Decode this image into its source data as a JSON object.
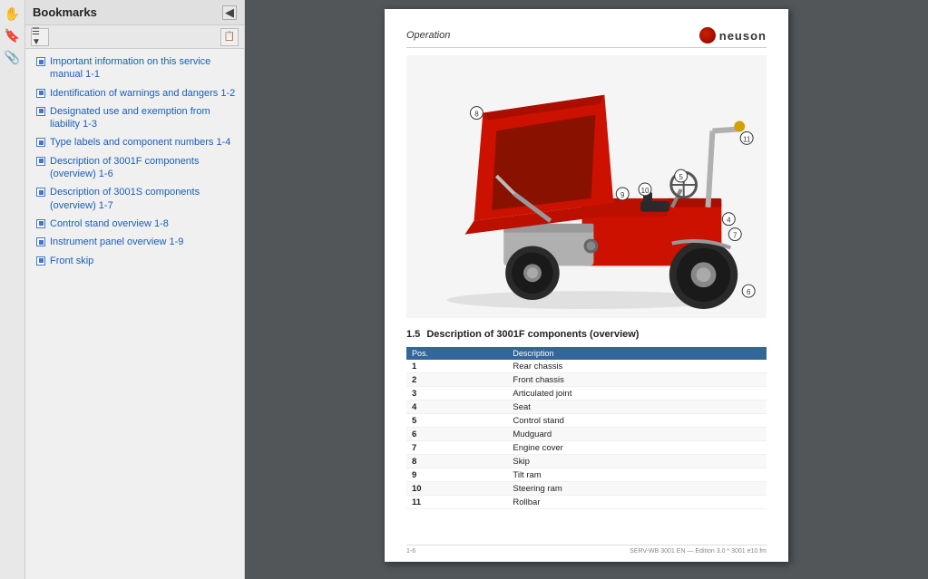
{
  "toolbar": {
    "icons": [
      {
        "name": "hand-icon",
        "symbol": "✋"
      },
      {
        "name": "bookmark-icon",
        "symbol": "🔖"
      },
      {
        "name": "paperclip-icon",
        "symbol": "📎"
      }
    ]
  },
  "bookmarks_panel": {
    "title": "Bookmarks",
    "close_label": "◀",
    "toolbar_buttons": [
      {
        "name": "options-button",
        "symbol": "☰"
      },
      {
        "name": "expand-button",
        "symbol": "▼"
      },
      {
        "name": "add-bookmark-button",
        "symbol": "📋"
      }
    ],
    "items": [
      {
        "id": 1,
        "text": "Important information on this service manual 1-1"
      },
      {
        "id": 2,
        "text": "Identification of warnings and dangers 1-2"
      },
      {
        "id": 3,
        "text": "Designated use and exemption from liability 1-3"
      },
      {
        "id": 4,
        "text": "Type labels and component numbers 1-4"
      },
      {
        "id": 5,
        "text": "Description of 3001F components (overview) 1-6"
      },
      {
        "id": 6,
        "text": "Description of 3001S components (overview) 1-7"
      },
      {
        "id": 7,
        "text": "Control stand overview 1-8"
      },
      {
        "id": 8,
        "text": "Instrument panel overview 1-9"
      },
      {
        "id": 9,
        "text": "Front skip"
      }
    ]
  },
  "document": {
    "header_title": "Operation",
    "logo_text": "neuson",
    "section_number": "1.5",
    "section_title": "Description of 3001F components (overview)",
    "table": {
      "col_pos": "Pos.",
      "col_desc": "Description",
      "rows": [
        {
          "pos": "1",
          "desc": "Rear chassis"
        },
        {
          "pos": "2",
          "desc": "Front chassis"
        },
        {
          "pos": "3",
          "desc": "Articulated joint"
        },
        {
          "pos": "4",
          "desc": "Seat"
        },
        {
          "pos": "5",
          "desc": "Control stand"
        },
        {
          "pos": "6",
          "desc": "Mudguard"
        },
        {
          "pos": "7",
          "desc": "Engine cover"
        },
        {
          "pos": "8",
          "desc": "Skip"
        },
        {
          "pos": "9",
          "desc": "Tilt ram"
        },
        {
          "pos": "10",
          "desc": "Steering ram"
        },
        {
          "pos": "11",
          "desc": "Rollbar"
        }
      ]
    },
    "footer_left": "1-6",
    "footer_right": "SERV-WB 3001 EN — Edition 3.0 * 3001 e10.fm"
  }
}
